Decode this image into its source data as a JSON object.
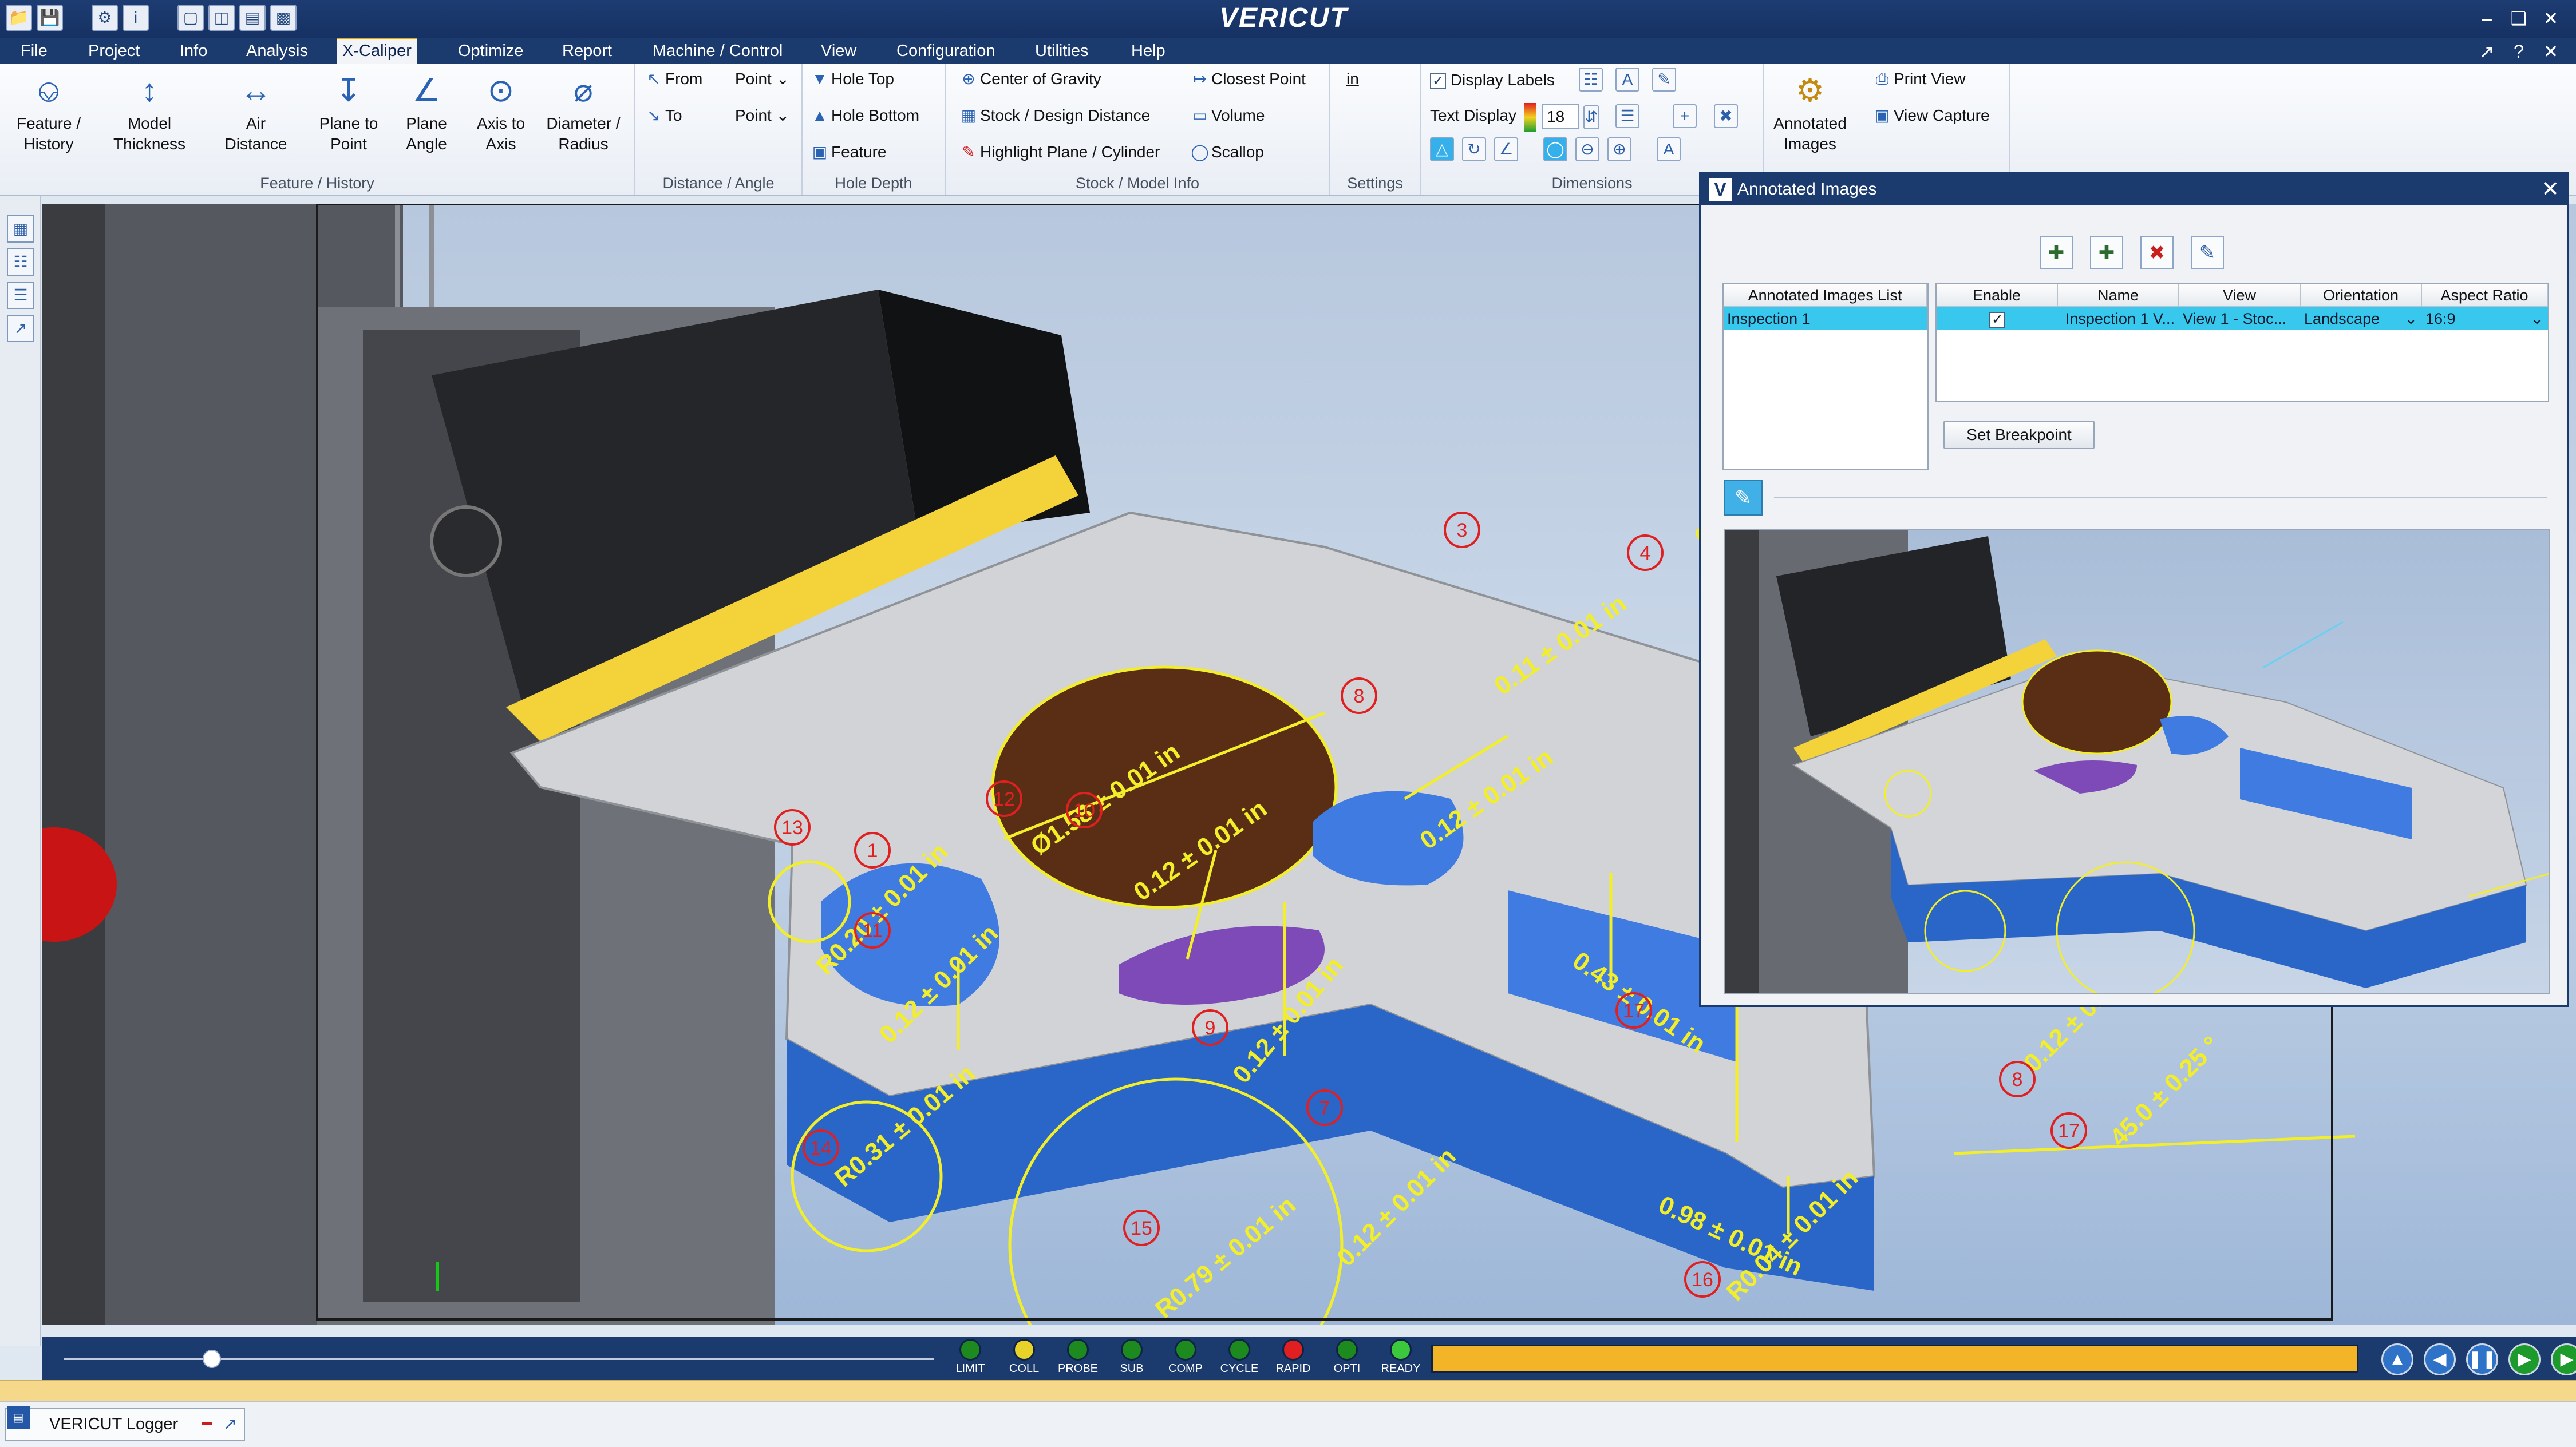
{
  "app": {
    "logo": "VERICUT"
  },
  "quick_access": [
    "folder-icon",
    "save-icon",
    "settings-icon",
    "info-icon",
    "layout-single-icon",
    "layout-split-icon",
    "layout-rows-icon",
    "layout-window-icon"
  ],
  "menu": {
    "items": [
      "File",
      "Project",
      "Info",
      "Analysis",
      "X-Caliper",
      "Optimize",
      "Report",
      "Machine / Control",
      "View",
      "Configuration",
      "Utilities",
      "Help"
    ],
    "active": "X-Caliper"
  },
  "ribbon": {
    "feature_history": {
      "label": "Feature / History",
      "buttons": [
        "Feature /\nHistory",
        "Model\nThickness",
        "Air\nDistance",
        "Plane to\nPoint",
        "Plane\nAngle",
        "Axis to\nAxis",
        "Diameter /\nRadius"
      ]
    },
    "distance_angle": {
      "label": "Distance / Angle",
      "from_label": "From",
      "from_value": "Point",
      "to_label": "To",
      "to_value": "Point"
    },
    "hole_depth": {
      "label": "Hole Depth",
      "items": [
        "Hole Top",
        "Hole Bottom",
        "Feature"
      ]
    },
    "stock_model_info": {
      "label": "Stock / Model Info",
      "items": [
        "Center of Gravity",
        "Stock / Design Distance",
        "Highlight Plane / Cylinder",
        "Closest Point",
        "Volume",
        "Scallop"
      ]
    },
    "settings": {
      "label": "Settings",
      "unit": "in"
    },
    "dimensions": {
      "label": "Dimensions",
      "display_labels": "Display Labels",
      "text_display": "Text Display",
      "text_size": "18"
    },
    "annotated": {
      "button": "Annotated\nImages",
      "print_view": "Print View",
      "view_capture": "View Capture"
    }
  },
  "viewport": {
    "annotations": [
      "0.11 ± 0.01 in",
      "0.12 ± 0.01 in",
      "Ø1.58 ± 0.01 in",
      "0.12 ± 0.01 in",
      "0.43 ± 0.01 in",
      "R0.20 ± 0.01 in",
      "0.12 ± 0.01 in",
      "0.12 ± 0.01 in",
      "R0.31 ± 0.01 in",
      "R0.79 ± 0.01 in",
      "0.12 ± 0.01 in",
      "0.98 ± 0.01 in",
      "0.12 ± 0.01 in",
      "45.0 ± 0.25 °",
      "R0.04 ± 0.01 in",
      "0.12"
    ],
    "markers": [
      "1",
      "3",
      "4",
      "7",
      "8",
      "9",
      "10",
      "11",
      "12",
      "13",
      "14",
      "15",
      "16",
      "17",
      "17",
      "8"
    ]
  },
  "panel": {
    "title": "Annotated Images",
    "list_header": "Annotated Images List",
    "list_items": [
      "Inspection 1"
    ],
    "grid_headers": [
      "Enable",
      "Name",
      "View",
      "Orientation",
      "Aspect Ratio"
    ],
    "grid_row": {
      "enabled": true,
      "name": "Inspection 1 V...",
      "view": "View 1 - Stoc...",
      "orientation": "Landscape",
      "aspect_ratio": "16:9"
    },
    "set_breakpoint": "Set Breakpoint",
    "tools": [
      "add-image-icon",
      "add-capture-icon",
      "delete-image-icon",
      "edit-image-icon"
    ]
  },
  "simulation": {
    "slider_position": 0.17,
    "leds": [
      {
        "label": "LIMIT",
        "color": "#1d8a1f"
      },
      {
        "label": "COLL",
        "color": "#e8d22a"
      },
      {
        "label": "PROBE",
        "color": "#1d8a1f"
      },
      {
        "label": "SUB",
        "color": "#1d8a1f"
      },
      {
        "label": "COMP",
        "color": "#1d8a1f"
      },
      {
        "label": "CYCLE",
        "color": "#1d8a1f"
      },
      {
        "label": "RAPID",
        "color": "#e02020"
      },
      {
        "label": "OPTI",
        "color": "#1d8a1f"
      },
      {
        "label": "READY",
        "color": "#3cc83c"
      }
    ],
    "progress_color": "#f4b428",
    "controls": [
      "rewind-icon",
      "step-back-icon",
      "pause-icon",
      "step-forward-icon",
      "play-icon"
    ]
  },
  "status": {
    "logger": "VERICUT Logger"
  },
  "colors": {
    "title_bar": "#1b3a6e",
    "annotation": "#f2ee2a",
    "marker": "#e02020",
    "part_blue": "#2a66c8"
  }
}
